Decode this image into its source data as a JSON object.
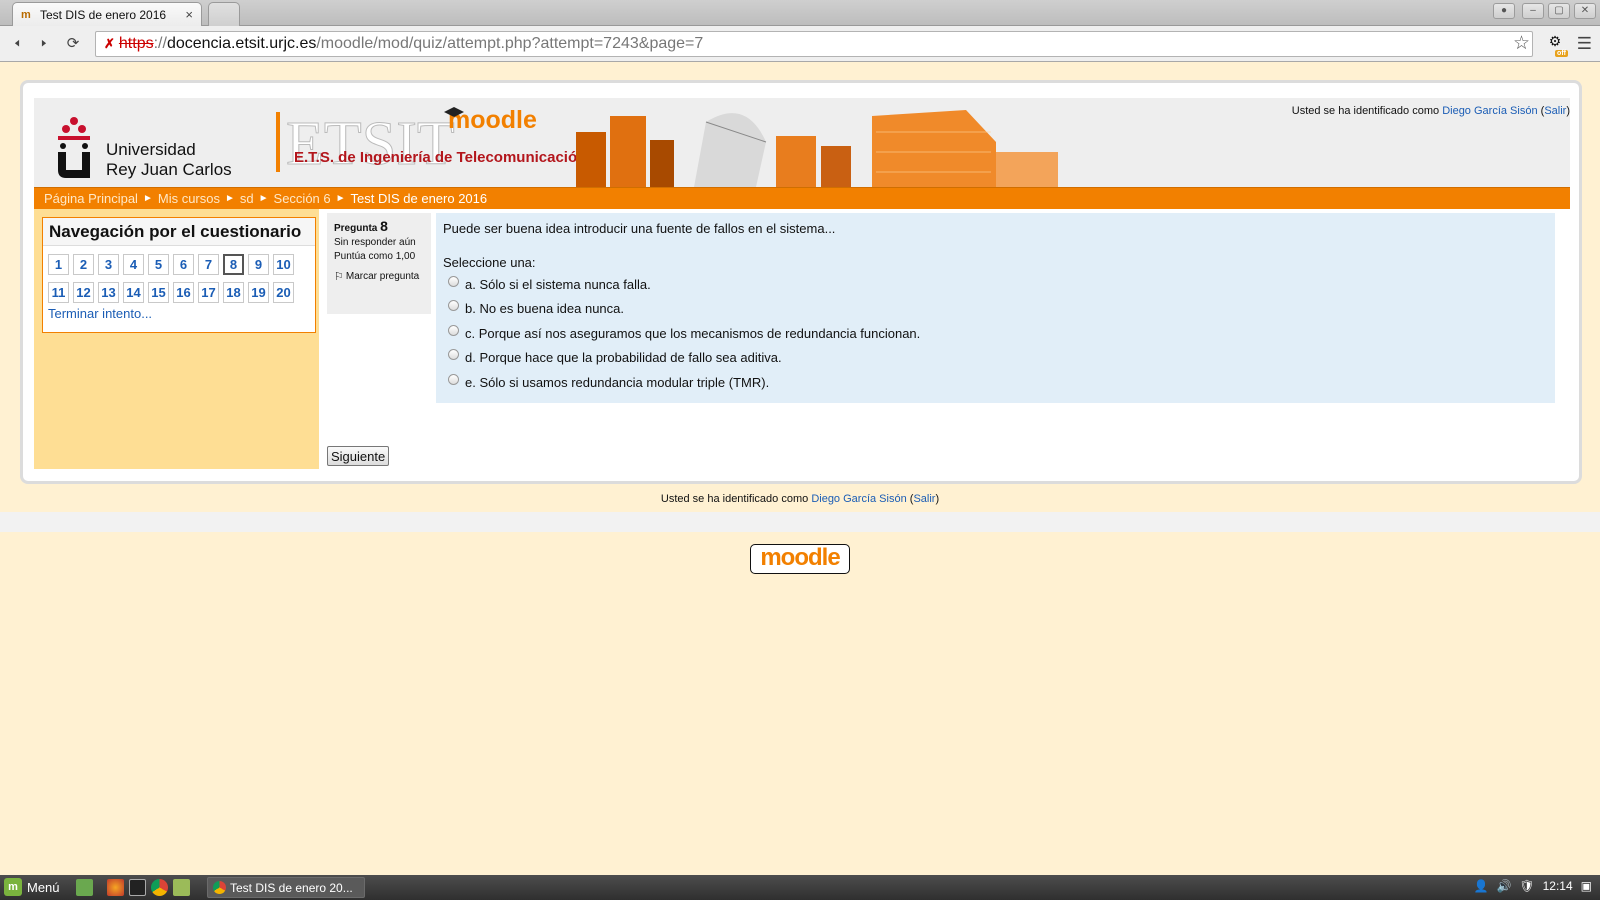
{
  "browser": {
    "tab_title": "Test DIS de enero 2016",
    "tab_close": "×",
    "url_scheme": "https",
    "url_sep": "://",
    "url_host": "docencia.etsit.urjc.es",
    "url_path": "/moodle/mod/quiz/attempt.php?attempt=7243&page=7"
  },
  "header": {
    "university_line1": "Universidad",
    "university_line2": "Rey Juan Carlos",
    "etsit_logo_text": "ETSIT",
    "moodle_logo_text": "moodle",
    "school_name": "E.T.S. de Ingeniería de Telecomunicación",
    "login_prefix": "Usted se ha identificado como",
    "user_name": "Diego García Sisón",
    "logout": "Salir"
  },
  "breadcrumb": [
    "Página Principal",
    "Mis cursos",
    "sd",
    "Sección 6",
    "Test DIS de enero 2016"
  ],
  "breadcrumb_sep": "►",
  "quiz_nav": {
    "title": "Navegación por el cuestionario",
    "questions": [
      "1",
      "2",
      "3",
      "4",
      "5",
      "6",
      "7",
      "8",
      "9",
      "10",
      "11",
      "12",
      "13",
      "14",
      "15",
      "16",
      "17",
      "18",
      "19",
      "20"
    ],
    "current": "8",
    "finish_label": "Terminar intento..."
  },
  "question": {
    "label": "Pregunta",
    "number": "8",
    "state": "Sin responder aún",
    "grade": "Puntúa como 1,00",
    "flag_label": "Marcar pregunta",
    "text": "Puede ser buena idea introducir una fuente de fallos en el sistema...",
    "prompt": "Seleccione una:",
    "options": [
      "a. Sólo si el sistema nunca falla.",
      "b. No es buena idea nunca.",
      "c. Porque así nos aseguramos que los mecanismos de redundancia funcionan.",
      "d. Porque hace que la probabilidad de fallo sea aditiva.",
      "e. Sólo si usamos redundancia modular triple (TMR)."
    ]
  },
  "next_button": "Siguiente",
  "footer": {
    "login_prefix": "Usted se ha identificado como",
    "user_name": "Diego García Sisón",
    "logout": "Salir",
    "moodle_logo": "moodle"
  },
  "taskbar": {
    "menu_label": "Menú",
    "task_title": "Test DIS de enero 20...",
    "clock": "12:14"
  },
  "colors": {
    "accent_orange": "#f28000",
    "sidebar_bg": "#fede94",
    "question_bg": "#e1eef8",
    "link": "#1b5db5"
  }
}
